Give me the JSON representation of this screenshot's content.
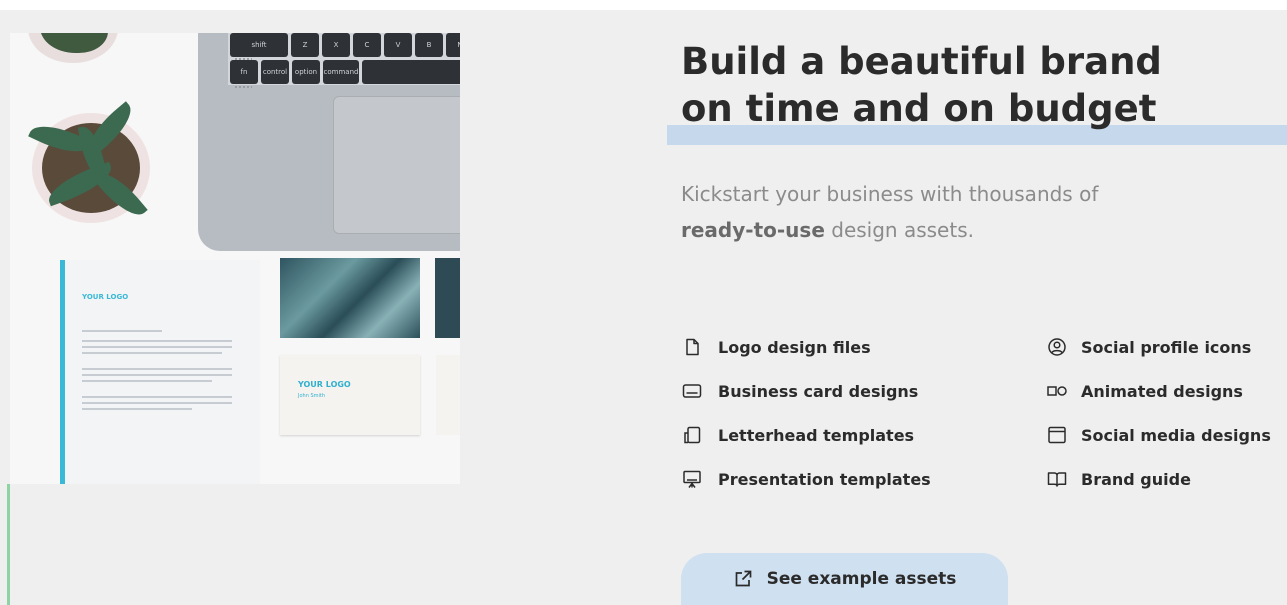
{
  "hero": {
    "title_line1": "Build a beautiful brand",
    "title_line2": "on time and on budget",
    "subtitle_before": "Kickstart your business with thousands of",
    "subtitle_bold": "ready-to-use",
    "subtitle_after": " design assets."
  },
  "image": {
    "keys": [
      "shift",
      "Z",
      "X",
      "C",
      "V",
      "B",
      "N",
      "fn",
      "control",
      "option",
      "command"
    ],
    "letterhead_logo": "YOUR LOGO",
    "card_logo": "YOUR LOGO",
    "card_name": "John Smith"
  },
  "features_left": [
    {
      "icon": "file-icon",
      "label": "Logo design files"
    },
    {
      "icon": "card-icon",
      "label": "Business card designs"
    },
    {
      "icon": "letterhead-icon",
      "label": "Letterhead templates"
    },
    {
      "icon": "presentation-icon",
      "label": "Presentation templates"
    }
  ],
  "features_right": [
    {
      "icon": "user-circle-icon",
      "label": "Social profile icons"
    },
    {
      "icon": "animated-icon",
      "label": "Animated designs"
    },
    {
      "icon": "window-icon",
      "label": "Social media designs"
    },
    {
      "icon": "book-icon",
      "label": "Brand guide"
    }
  ],
  "cta": {
    "label": "See example assets",
    "icon": "external-link-icon"
  },
  "colors": {
    "background": "#efefef",
    "underline": "#c6d9ec",
    "cta_bg": "#cfe0f1",
    "accent_green": "#8fd3a4",
    "logo_blue": "#39b9d6"
  }
}
